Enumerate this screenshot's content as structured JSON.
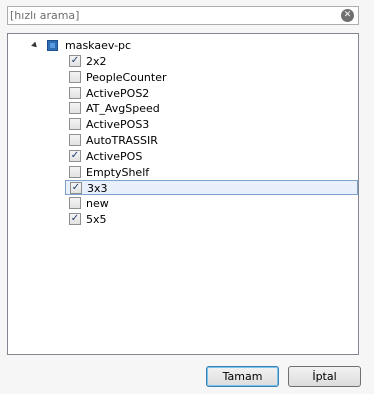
{
  "search": {
    "placeholder": "[hızlı arama]",
    "value": ""
  },
  "tree": {
    "root": {
      "label": "maskaev-pc",
      "expanded": true
    },
    "items": [
      {
        "label": "2x2",
        "checked": true,
        "selected": false
      },
      {
        "label": "PeopleCounter",
        "checked": false,
        "selected": false
      },
      {
        "label": "ActivePOS2",
        "checked": false,
        "selected": false
      },
      {
        "label": "AT_AvgSpeed",
        "checked": false,
        "selected": false
      },
      {
        "label": "ActivePOS3",
        "checked": false,
        "selected": false
      },
      {
        "label": "AutoTRASSIR",
        "checked": false,
        "selected": false
      },
      {
        "label": "ActivePOS",
        "checked": true,
        "selected": false
      },
      {
        "label": "EmptyShelf",
        "checked": false,
        "selected": false
      },
      {
        "label": "3x3",
        "checked": true,
        "selected": true
      },
      {
        "label": "new",
        "checked": false,
        "selected": false
      },
      {
        "label": "5x5",
        "checked": true,
        "selected": false
      }
    ]
  },
  "buttons": {
    "ok_label": "Tamam",
    "cancel_label": "İptal"
  },
  "colors": {
    "selection_bg": "#e8f1fb",
    "selection_border": "#7da2ce",
    "root_icon": "#2d6db5"
  }
}
